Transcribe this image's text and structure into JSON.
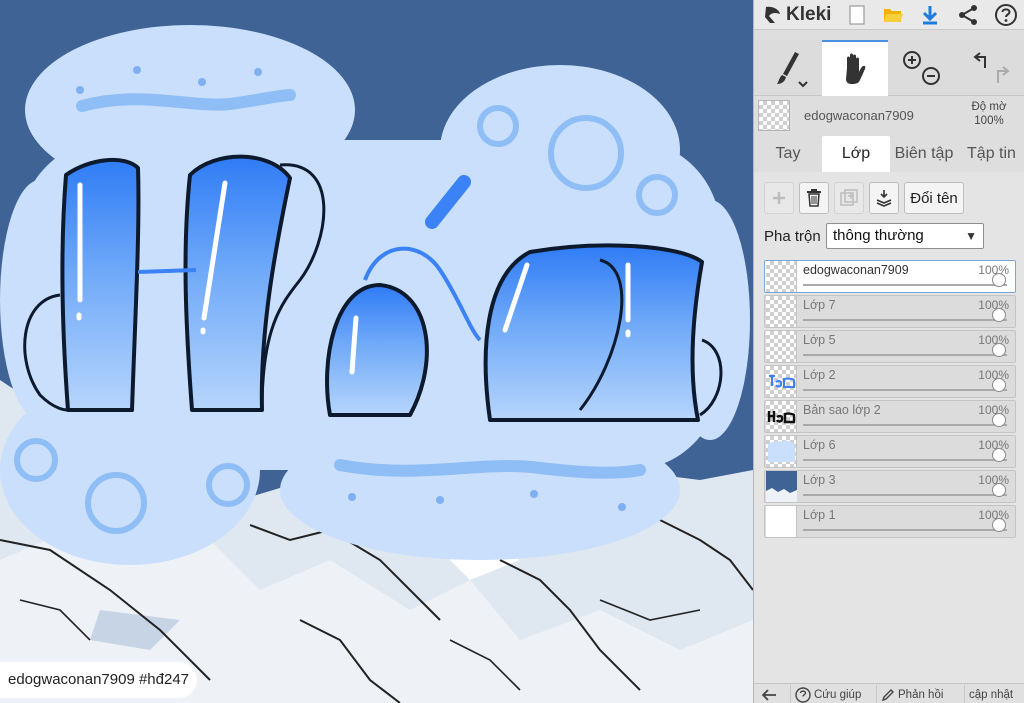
{
  "app": {
    "name": "Kleki"
  },
  "canvas": {
    "title_art_text": "Hóa",
    "caption": "edogwaconan7909  #hđ247"
  },
  "toolbar": {
    "active_tool": "hand-tool"
  },
  "current_layer": {
    "name": "edogwaconan7909",
    "opacity_label": "Độ mờ",
    "opacity_value": "100%"
  },
  "tabs": [
    {
      "label": "Tay",
      "active": false
    },
    {
      "label": "Lớp",
      "active": true
    },
    {
      "label": "Biên tập",
      "active": false
    },
    {
      "label": "Tập tin",
      "active": false
    }
  ],
  "layer_panel": {
    "rename_label": "Đổi tên",
    "blend_label": "Pha trộn",
    "blend_value": "thông thường",
    "layers": [
      {
        "name": "edogwaconan7909",
        "opacity": "100%",
        "active": true
      },
      {
        "name": "Lớp 7",
        "opacity": "100%",
        "active": false
      },
      {
        "name": "Lớp 5",
        "opacity": "100%",
        "active": false
      },
      {
        "name": "Lớp 2",
        "opacity": "100%",
        "active": false
      },
      {
        "name": "Bản sao lớp 2",
        "opacity": "100%",
        "active": false
      },
      {
        "name": "Lớp 6",
        "opacity": "100%",
        "active": false
      },
      {
        "name": "Lớp 3",
        "opacity": "100%",
        "active": false
      },
      {
        "name": "Lớp 1",
        "opacity": "100%",
        "active": false
      }
    ]
  },
  "bottom_bar": {
    "help_label": "Cứu giúp",
    "feedback_label": "Phản hồi",
    "update_label": "cập nhật"
  },
  "colors": {
    "sky": "#3e6394",
    "cloud": "#c9dffb",
    "accent": "#4a90e2",
    "letter_top": "#2f7cf6",
    "letter_bottom": "#a9cdfb"
  }
}
